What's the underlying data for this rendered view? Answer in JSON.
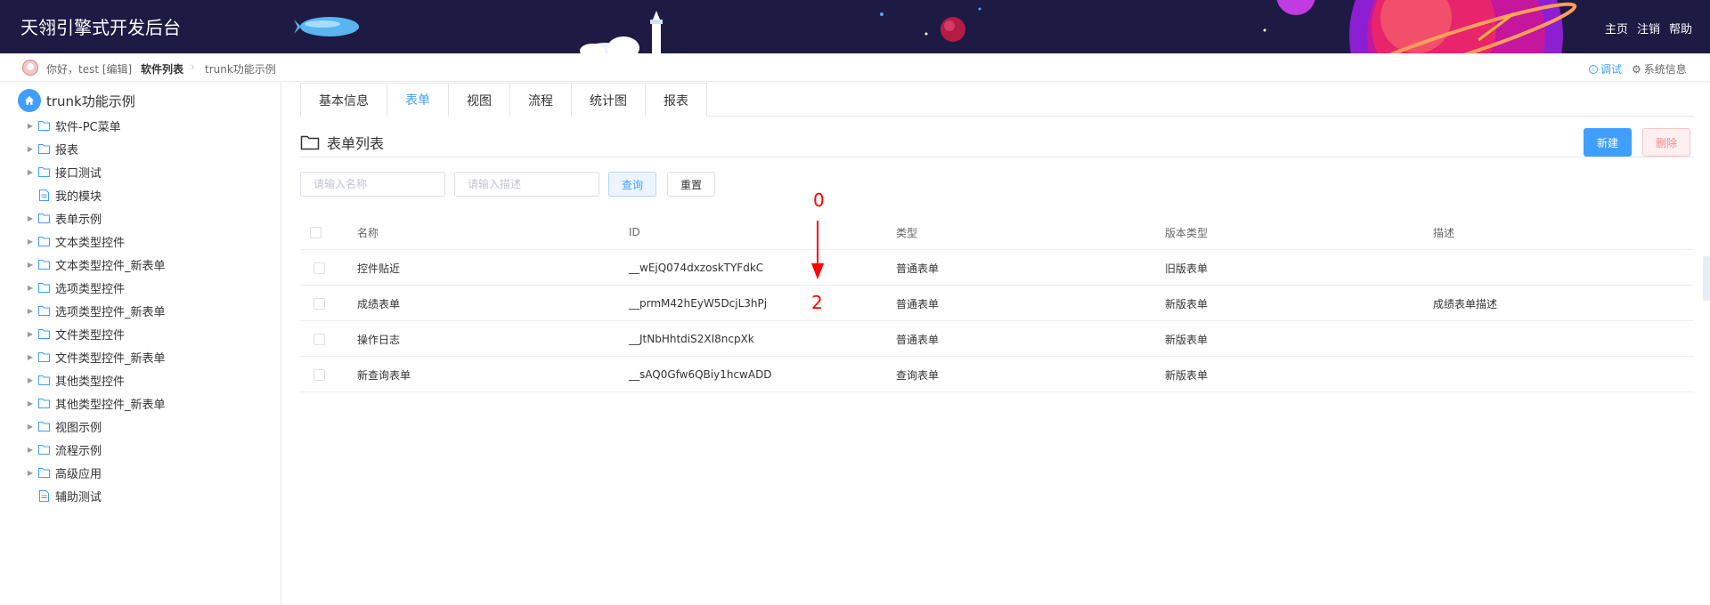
{
  "header": {
    "title": "天翎引擎式开发后台",
    "nav": [
      "主页",
      "注销",
      "帮助"
    ]
  },
  "breadcrumb": {
    "greeting": "你好，test [编辑]",
    "current": "软件列表",
    "page": "trunk功能示例",
    "debug_label": "调试",
    "sysinfo_label": "系统信息"
  },
  "sidebar": {
    "root": "trunk功能示例",
    "items": [
      {
        "label": "软件-PC菜单",
        "type": "folder"
      },
      {
        "label": "报表",
        "type": "folder"
      },
      {
        "label": "接口测试",
        "type": "folder"
      },
      {
        "label": "我的模块",
        "type": "file"
      },
      {
        "label": "表单示例",
        "type": "folder"
      },
      {
        "label": "文本类型控件",
        "type": "folder"
      },
      {
        "label": "文本类型控件_新表单",
        "type": "folder"
      },
      {
        "label": "选项类型控件",
        "type": "folder"
      },
      {
        "label": "选项类型控件_新表单",
        "type": "folder"
      },
      {
        "label": "文件类型控件",
        "type": "folder"
      },
      {
        "label": "文件类型控件_新表单",
        "type": "folder"
      },
      {
        "label": "其他类型控件",
        "type": "folder"
      },
      {
        "label": "其他类型控件_新表单",
        "type": "folder"
      },
      {
        "label": "视图示例",
        "type": "folder"
      },
      {
        "label": "流程示例",
        "type": "folder"
      },
      {
        "label": "高级应用",
        "type": "folder"
      },
      {
        "label": "辅助测试",
        "type": "file"
      }
    ]
  },
  "tabs": [
    {
      "label": "基本信息",
      "active": false
    },
    {
      "label": "表单",
      "active": true
    },
    {
      "label": "视图",
      "active": false
    },
    {
      "label": "流程",
      "active": false
    },
    {
      "label": "统计图",
      "active": false
    },
    {
      "label": "报表",
      "active": false
    }
  ],
  "section": {
    "title": "表单列表",
    "new_label": "新建",
    "delete_label": "删除"
  },
  "search": {
    "name_placeholder": "请输入名称",
    "desc_placeholder": "请输入描述",
    "query_label": "查询",
    "reset_label": "重置"
  },
  "table": {
    "headers": [
      "名称",
      "ID",
      "类型",
      "版本类型",
      "描述"
    ],
    "rows": [
      [
        "控件贴近",
        "__wEjQ074dxzoskTYFdkC",
        "普通表单",
        "旧版表单",
        ""
      ],
      [
        "成绩表单",
        "__prmM42hEyW5DcjL3hPj",
        "普通表单",
        "新版表单",
        "成绩表单描述"
      ],
      [
        "操作日志",
        "__JtNbHhtdiS2XI8ncpXk",
        "普通表单",
        "新版表单",
        ""
      ],
      [
        "新查询表单",
        "__sAQ0Gfw6QBiy1hcwADD",
        "查询表单",
        "新版表单",
        ""
      ]
    ]
  },
  "annotation": {
    "top": "0",
    "bottom": "2"
  },
  "colors": {
    "header_bg": "#1d1a43",
    "accent": "#409eff",
    "danger": "#f78989",
    "annotation": "#ff0000"
  }
}
